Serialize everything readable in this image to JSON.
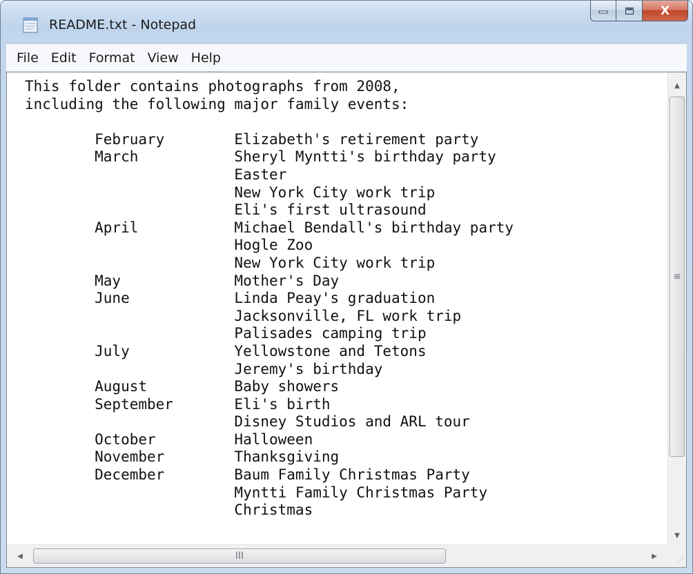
{
  "window": {
    "title": "README.txt - Notepad",
    "app_icon": "notepad-icon",
    "controls": {
      "minimize_icon": "minimize-icon",
      "maximize_icon": "maximize-icon",
      "close_label": "X"
    },
    "colors": {
      "frame": "#c4d7ec",
      "close_button": "#c0452a",
      "editor_background": "#ffffff"
    }
  },
  "menubar": {
    "items": [
      {
        "label": "File"
      },
      {
        "label": "Edit"
      },
      {
        "label": "Format"
      },
      {
        "label": "View"
      },
      {
        "label": "Help"
      }
    ]
  },
  "document": {
    "lines": [
      "This folder contains photographs from 2008,",
      "including the following major family events:",
      "",
      "        February        Elizabeth's retirement party",
      "        March           Sheryl Myntti's birthday party",
      "                        Easter",
      "                        New York City work trip",
      "                        Eli's first ultrasound",
      "        April           Michael Bendall's birthday party",
      "                        Hogle Zoo",
      "                        New York City work trip",
      "        May             Mother's Day",
      "        June            Linda Peay's graduation",
      "                        Jacksonville, FL work trip",
      "                        Palisades camping trip",
      "        July            Yellowstone and Tetons",
      "                        Jeremy's birthday",
      "        August          Baby showers",
      "        September       Eli's birth",
      "                        Disney Studios and ARL tour",
      "        October         Halloween",
      "        November        Thanksgiving",
      "        December        Baum Family Christmas Party",
      "                        Myntti Family Christmas Party",
      "                        Christmas"
    ]
  },
  "scrollbars": {
    "vertical": {
      "up_icon": "scroll-up-arrow-icon",
      "down_icon": "scroll-down-arrow-icon",
      "grip_glyph": "≡"
    },
    "horizontal": {
      "left_icon": "scroll-left-arrow-icon",
      "right_icon": "scroll-right-arrow-icon",
      "grip_glyph": "III"
    }
  }
}
